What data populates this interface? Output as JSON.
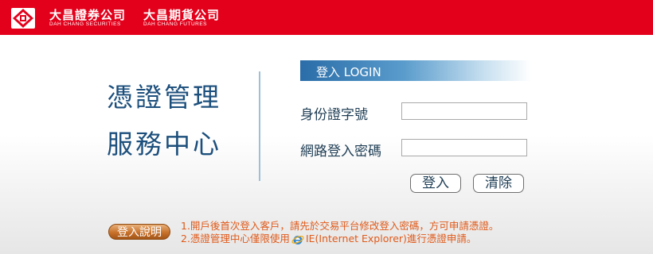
{
  "header": {
    "logo_icon": "dah-chang-logo-icon",
    "securities_cn": "大昌證券公司",
    "securities_en": "DAH CHANG SECURITIES",
    "futures_cn": "大昌期貨公司",
    "futures_en": "DAH CHANG FUTURES",
    "brand_color": "#e3001b"
  },
  "service": {
    "line1": "憑證管理",
    "line2": "服務中心",
    "color": "#1c4f7c"
  },
  "login": {
    "title": "登入 LOGIN",
    "id_label": "身份證字號",
    "id_value": "",
    "password_label": "網路登入密碼",
    "password_value": "",
    "submit_label": "登入",
    "clear_label": "清除"
  },
  "help": {
    "button_label": "登入說明",
    "note1": "1.開戶後首次登入客戶，請先於交易平台修改登入密碼，方可申請憑證。",
    "note2_prefix": "2.憑證管理中心僅限使用",
    "note2_icon": "internet-explorer-icon",
    "note2_suffix": "IE(Internet Explorer)進行憑證申請。",
    "note_color": "#e05a1a"
  }
}
